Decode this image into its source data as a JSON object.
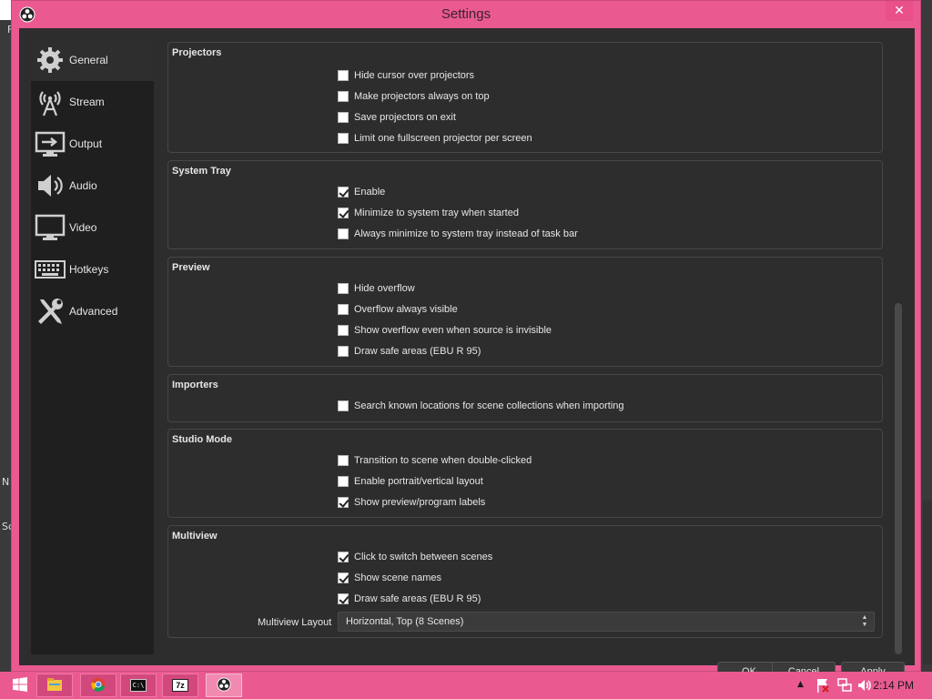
{
  "window": {
    "title": "Settings",
    "close_glyph": "✕"
  },
  "background": {
    "menu_letter": "F",
    "label_n": "N",
    "label_sc": "Sc"
  },
  "sidebar": {
    "items": [
      {
        "label": "General",
        "icon": "gear-icon",
        "active": true
      },
      {
        "label": "Stream",
        "icon": "antenna-icon",
        "active": false
      },
      {
        "label": "Output",
        "icon": "output-monitor-icon",
        "active": false
      },
      {
        "label": "Audio",
        "icon": "speaker-icon",
        "active": false
      },
      {
        "label": "Video",
        "icon": "monitor-icon",
        "active": false
      },
      {
        "label": "Hotkeys",
        "icon": "keyboard-icon",
        "active": false
      },
      {
        "label": "Advanced",
        "icon": "wrench-screwdriver-icon",
        "active": false
      }
    ]
  },
  "groups": {
    "projectors": {
      "title": "Projectors",
      "options": [
        {
          "label": "Hide cursor over projectors",
          "checked": false
        },
        {
          "label": "Make projectors always on top",
          "checked": false
        },
        {
          "label": "Save projectors on exit",
          "checked": false
        },
        {
          "label": "Limit one fullscreen projector per screen",
          "checked": false
        }
      ]
    },
    "system_tray": {
      "title": "System Tray",
      "options": [
        {
          "label": "Enable",
          "checked": true
        },
        {
          "label": "Minimize to system tray when started",
          "checked": true
        },
        {
          "label": "Always minimize to system tray instead of task bar",
          "checked": false
        }
      ]
    },
    "preview": {
      "title": "Preview",
      "options": [
        {
          "label": "Hide overflow",
          "checked": false
        },
        {
          "label": "Overflow always visible",
          "checked": false
        },
        {
          "label": "Show overflow even when source is invisible",
          "checked": false
        },
        {
          "label": "Draw safe areas (EBU R 95)",
          "checked": false
        }
      ]
    },
    "importers": {
      "title": "Importers",
      "options": [
        {
          "label": "Search known locations for scene collections when importing",
          "checked": false
        }
      ]
    },
    "studio_mode": {
      "title": "Studio Mode",
      "options": [
        {
          "label": "Transition to scene when double-clicked",
          "checked": false
        },
        {
          "label": "Enable portrait/vertical layout",
          "checked": false
        },
        {
          "label": "Show preview/program labels",
          "checked": true
        }
      ]
    },
    "multiview": {
      "title": "Multiview",
      "options": [
        {
          "label": "Click to switch between scenes",
          "checked": true
        },
        {
          "label": "Show scene names",
          "checked": true
        },
        {
          "label": "Draw safe areas (EBU R 95)",
          "checked": true
        }
      ],
      "layout_label": "Multiview Layout",
      "layout_value": "Horizontal, Top (8 Scenes)"
    }
  },
  "buttons": {
    "ok": "OK",
    "cancel": "Cancel",
    "apply": "Apply"
  },
  "taskbar": {
    "items": [
      "windows-start-icon",
      "file-explorer-icon",
      "chrome-icon",
      "command-prompt-icon",
      "7zip-icon",
      "obs-icon"
    ],
    "sevenzip_text": "7z",
    "cmd_text": "C:\\",
    "clock": "2:14 PM"
  },
  "colors": {
    "accent": "#ea5a90",
    "panel": "#2d2d2d",
    "sidebar": "#1f1f1f"
  }
}
